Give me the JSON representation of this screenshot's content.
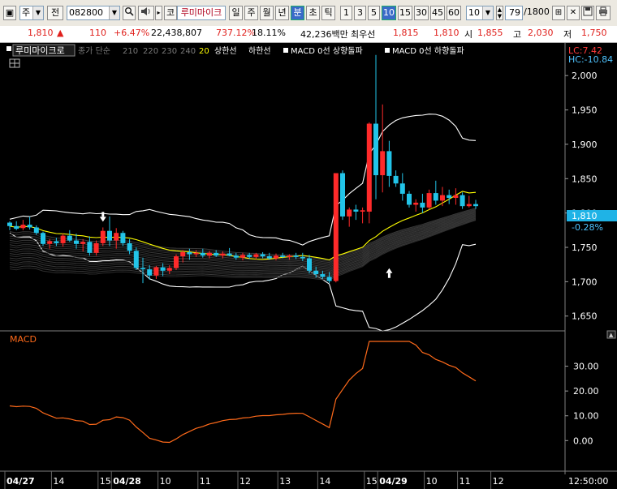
{
  "toolbar": {
    "market": "주",
    "mode": "전",
    "code": "082800",
    "name_btn": "코",
    "name": "루미마이크",
    "period_buttons": [
      {
        "label": "일",
        "active": false
      },
      {
        "label": "주",
        "active": false
      },
      {
        "label": "월",
        "active": false
      },
      {
        "label": "년",
        "active": false
      },
      {
        "label": "분",
        "active": true
      },
      {
        "label": "초",
        "active": false
      },
      {
        "label": "틱",
        "active": false
      }
    ],
    "interval_buttons": [
      {
        "label": "1",
        "active": false
      },
      {
        "label": "3",
        "active": false
      },
      {
        "label": "5",
        "active": false
      },
      {
        "label": "10",
        "active": true
      },
      {
        "label": "15",
        "active": false
      },
      {
        "label": "30",
        "active": false
      },
      {
        "label": "45",
        "active": false
      },
      {
        "label": "60",
        "active": false
      }
    ],
    "interval_value": "10",
    "count": "79",
    "count_total": "/1800"
  },
  "quote": {
    "price": "1,810",
    "up_arrow": "▲",
    "change": "110",
    "change_pct": "+6.47%",
    "volume": "22,438,807",
    "volume_ratio": "737.12%",
    "turnover": "18.11%",
    "amount": "42,236백만",
    "bid_label": "최우선",
    "ask_price": "1,815",
    "bid_price": "1,810",
    "open_label": "시",
    "open": "1,855",
    "high_label": "고",
    "high": "2,030",
    "low_label": "저",
    "low": "1,750"
  },
  "legend": {
    "name": "루미마이크로",
    "ma_prefix": "종가 단순",
    "ma_periods": [
      "210",
      "220",
      "230",
      "240",
      "20"
    ],
    "items": [
      "상한선",
      "하한선",
      "MACD 0선 상향돌파",
      "MACD 0선 하향돌파"
    ]
  },
  "price_axis": {
    "ticks": [
      "2,000",
      "1,950",
      "1,900",
      "1,850",
      "1,800",
      "1,750",
      "1,700",
      "1,650"
    ],
    "lc": "LC:7.42",
    "hc": "HC:-10.84",
    "current": "1,810",
    "current_pct": "-0.28%"
  },
  "macd": {
    "label": "MACD",
    "ticks": [
      "30.00",
      "20.00",
      "10.00",
      "0.00"
    ]
  },
  "time_axis": {
    "labels": [
      "04/27",
      "14",
      "15",
      "04/28",
      "10",
      "11",
      "12",
      "13",
      "14",
      "15",
      "04/29",
      "10",
      "11",
      "12"
    ],
    "clock": "12:50:00"
  },
  "colors": {
    "up": "#ff2a2a",
    "down": "#22c4e8",
    "band": "#ffffff",
    "ma": "#ffff00",
    "macd": "#ff6a1a"
  },
  "chart_data": {
    "type": "candlestick",
    "ylim": [
      1632,
      2038
    ],
    "candles": [
      [
        1786,
        1788,
        1775,
        1781
      ],
      [
        1781,
        1788,
        1775,
        1777
      ],
      [
        1778,
        1790,
        1775,
        1783
      ],
      [
        1783,
        1795,
        1776,
        1779
      ],
      [
        1779,
        1782,
        1768,
        1771
      ],
      [
        1771,
        1773,
        1752,
        1755
      ],
      [
        1755,
        1762,
        1748,
        1759
      ],
      [
        1759,
        1764,
        1752,
        1756
      ],
      [
        1756,
        1770,
        1751,
        1767
      ],
      [
        1767,
        1775,
        1758,
        1760
      ],
      [
        1760,
        1770,
        1748,
        1755
      ],
      [
        1755,
        1762,
        1744,
        1758
      ],
      [
        1758,
        1766,
        1738,
        1742
      ],
      [
        1742,
        1760,
        1738,
        1756
      ],
      [
        1756,
        1779,
        1752,
        1774
      ],
      [
        1774,
        1795,
        1752,
        1760
      ],
      [
        1760,
        1778,
        1748,
        1771
      ],
      [
        1771,
        1774,
        1752,
        1756
      ],
      [
        1756,
        1762,
        1740,
        1745
      ],
      [
        1745,
        1750,
        1717,
        1720
      ],
      [
        1720,
        1735,
        1698,
        1718
      ],
      [
        1718,
        1724,
        1703,
        1709
      ],
      [
        1709,
        1723,
        1704,
        1721
      ],
      [
        1721,
        1727,
        1708,
        1716
      ],
      [
        1716,
        1724,
        1711,
        1720
      ],
      [
        1720,
        1740,
        1717,
        1737
      ],
      [
        1737,
        1746,
        1728,
        1743
      ],
      [
        1743,
        1748,
        1732,
        1740
      ],
      [
        1740,
        1746,
        1736,
        1742
      ],
      [
        1742,
        1748,
        1735,
        1738
      ],
      [
        1738,
        1745,
        1734,
        1742
      ],
      [
        1742,
        1746,
        1736,
        1738
      ],
      [
        1738,
        1744,
        1734,
        1741
      ],
      [
        1741,
        1749,
        1737,
        1738
      ],
      [
        1738,
        1742,
        1732,
        1735
      ],
      [
        1735,
        1742,
        1731,
        1739
      ],
      [
        1739,
        1742,
        1733,
        1736
      ],
      [
        1736,
        1742,
        1733,
        1740
      ],
      [
        1740,
        1743,
        1734,
        1737
      ],
      [
        1737,
        1742,
        1732,
        1734
      ],
      [
        1734,
        1741,
        1731,
        1738
      ],
      [
        1738,
        1742,
        1734,
        1736
      ],
      [
        1736,
        1740,
        1732,
        1738
      ],
      [
        1738,
        1742,
        1733,
        1736
      ],
      [
        1736,
        1742,
        1730,
        1734
      ],
      [
        1734,
        1739,
        1712,
        1716
      ],
      [
        1716,
        1722,
        1706,
        1711
      ],
      [
        1711,
        1716,
        1704,
        1707
      ],
      [
        1707,
        1714,
        1698,
        1701
      ],
      [
        1701,
        1763,
        1699,
        1858
      ],
      [
        1858,
        1862,
        1790,
        1795
      ],
      [
        1795,
        1808,
        1780,
        1805
      ],
      [
        1805,
        1812,
        1790,
        1802
      ],
      [
        1802,
        1808,
        1785,
        1804
      ],
      [
        1802,
        1932,
        1785,
        1930
      ],
      [
        1930,
        2030,
        1820,
        1855
      ],
      [
        1855,
        1958,
        1830,
        1890
      ],
      [
        1890,
        1905,
        1838,
        1854
      ],
      [
        1854,
        1862,
        1838,
        1843
      ],
      [
        1843,
        1858,
        1818,
        1828
      ],
      [
        1828,
        1832,
        1808,
        1812
      ],
      [
        1812,
        1820,
        1802,
        1815
      ],
      [
        1815,
        1828,
        1800,
        1808
      ],
      [
        1808,
        1834,
        1805,
        1829
      ],
      [
        1829,
        1847,
        1812,
        1818
      ],
      [
        1818,
        1838,
        1810,
        1826
      ],
      [
        1826,
        1834,
        1813,
        1822
      ],
      [
        1822,
        1836,
        1812,
        1826
      ],
      [
        1826,
        1830,
        1806,
        1810
      ],
      [
        1810,
        1825,
        1808,
        1813
      ],
      [
        1813,
        1819,
        1806,
        1810
      ]
    ]
  }
}
